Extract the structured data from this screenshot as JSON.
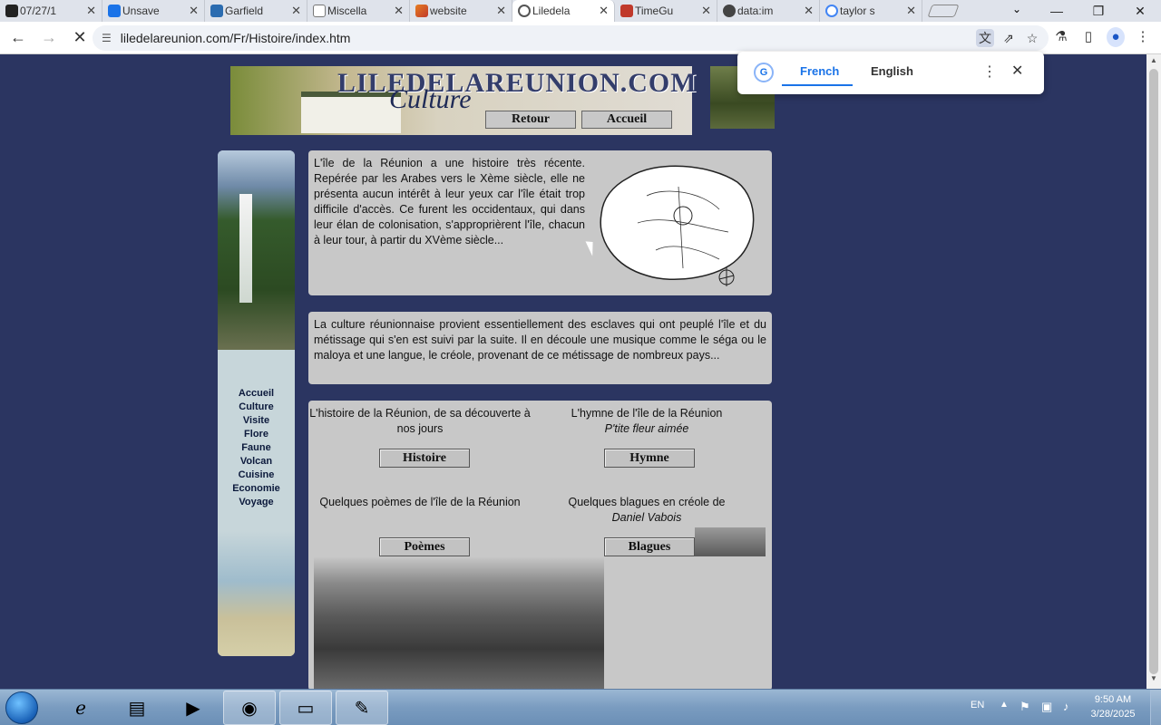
{
  "tabs": [
    {
      "title": "07/27/1",
      "favicon_color": "#222222"
    },
    {
      "title": "Unsave",
      "favicon_color": "#1a73e8"
    },
    {
      "title": "Garfield",
      "favicon_color": "#2b6cb0"
    },
    {
      "title": "Miscella",
      "favicon_color": "#777777"
    },
    {
      "title": "website",
      "favicon_color": "#e67e22"
    },
    {
      "title": "Liledela",
      "favicon_color": "#555555"
    },
    {
      "title": "TimeGu",
      "favicon_color": "#c0392b"
    },
    {
      "title": "data:im",
      "favicon_color": "#444444"
    },
    {
      "title": "taylor s",
      "favicon_color": "#4285f4"
    }
  ],
  "active_tab_index": 5,
  "address_bar": {
    "url": "liledelareunion.com/Fr/Histoire/index.htm"
  },
  "translate_popup": {
    "source": "French",
    "target": "English"
  },
  "banner": {
    "logo_text": "LILEDELAREUNION.COM",
    "subtitle": "Culture",
    "button_back": "Retour",
    "button_home": "Accueil"
  },
  "sidebar": {
    "items": [
      "Accueil",
      "Culture",
      "Visite",
      "Flore",
      "Faune",
      "Volcan",
      "Cuisine",
      "Economie",
      "Voyage"
    ]
  },
  "intro_text": "L'île de la Réunion a une histoire très récente. Repérée par les Arabes vers le Xème siècle, elle ne présenta aucun intérêt à leur yeux car l'île était trop difficile d'accès. Ce furent les occidentaux, qui dans leur élan de colonisation, s'approprièrent l'île, chacun à leur tour, à partir du XVème siècle...",
  "culture_text": "La culture réunionnaise provient essentiellement des esclaves qui ont peuplé l'île et du métissage qui s'en est suivi par la suite. Il en découle une musique comme le séga ou le maloya et une langue, le créole, provenant de ce métissage de nombreux pays...",
  "grid": {
    "history": {
      "text": "L'histoire de la Réunion, de sa découverte à nos jours",
      "button": "Histoire"
    },
    "anthem": {
      "text": "L'hymne de l'île de la Réunion",
      "italic": "P'tite fleur aimée",
      "button": "Hymne"
    },
    "poems": {
      "text": "Quelques poèmes de l'île de la Réunion",
      "button": "Poèmes"
    },
    "jokes": {
      "text": "Quelques blagues en créole de",
      "italic": "Daniel Vabois",
      "button": "Blagues"
    }
  },
  "taskbar": {
    "language": "EN",
    "time": "9:50 AM",
    "date": "3/28/2025"
  }
}
